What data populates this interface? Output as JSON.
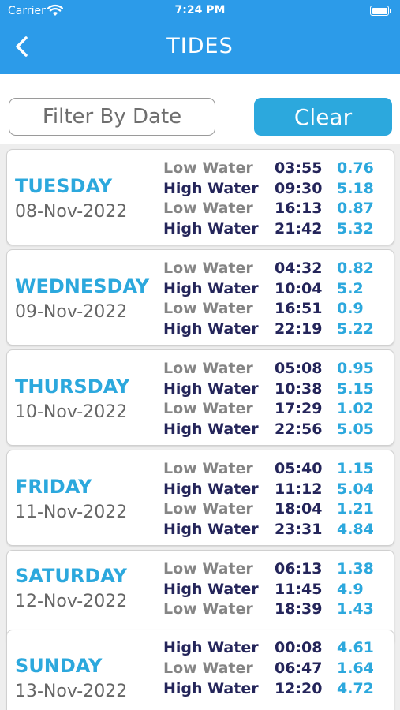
{
  "status_bar": {
    "carrier": "Carrier",
    "time": "7:24 PM"
  },
  "header": {
    "title": "TIDES",
    "back_icon": "chevron-left-icon"
  },
  "filter": {
    "placeholder": "Filter By Date",
    "clear_label": "Clear"
  },
  "days": [
    {
      "day": "TUESDAY",
      "date": "08-Nov-2022",
      "tides": [
        {
          "type": "Low Water",
          "time": "03:55",
          "height": "0.76"
        },
        {
          "type": "High Water",
          "time": "09:30",
          "height": "5.18"
        },
        {
          "type": "Low Water",
          "time": "16:13",
          "height": "0.87"
        },
        {
          "type": "High Water",
          "time": "21:42",
          "height": "5.32"
        }
      ]
    },
    {
      "day": "WEDNESDAY",
      "date": "09-Nov-2022",
      "tides": [
        {
          "type": "Low Water",
          "time": "04:32",
          "height": "0.82"
        },
        {
          "type": "High Water",
          "time": "10:04",
          "height": "5.2"
        },
        {
          "type": "Low Water",
          "time": "16:51",
          "height": "0.9"
        },
        {
          "type": "High Water",
          "time": "22:19",
          "height": "5.22"
        }
      ]
    },
    {
      "day": "THURSDAY",
      "date": "10-Nov-2022",
      "tides": [
        {
          "type": "Low Water",
          "time": "05:08",
          "height": "0.95"
        },
        {
          "type": "High Water",
          "time": "10:38",
          "height": "5.15"
        },
        {
          "type": "Low Water",
          "time": "17:29",
          "height": "1.02"
        },
        {
          "type": "High Water",
          "time": "22:56",
          "height": "5.05"
        }
      ]
    },
    {
      "day": "FRIDAY",
      "date": "11-Nov-2022",
      "tides": [
        {
          "type": "Low Water",
          "time": "05:40",
          "height": "1.15"
        },
        {
          "type": "High Water",
          "time": "11:12",
          "height": "5.04"
        },
        {
          "type": "Low Water",
          "time": "18:04",
          "height": "1.21"
        },
        {
          "type": "High Water",
          "time": "23:31",
          "height": "4.84"
        }
      ]
    },
    {
      "day": "SATURDAY",
      "date": "12-Nov-2022",
      "tides": [
        {
          "type": "Low Water",
          "time": "06:13",
          "height": "1.38"
        },
        {
          "type": "High Water",
          "time": "11:45",
          "height": "4.9"
        },
        {
          "type": "Low Water",
          "time": "18:39",
          "height": "1.43"
        }
      ]
    },
    {
      "day": "SUNDAY",
      "date": "13-Nov-2022",
      "tides": [
        {
          "type": "High Water",
          "time": "00:08",
          "height": "4.61"
        },
        {
          "type": "Low Water",
          "time": "06:47",
          "height": "1.64"
        },
        {
          "type": "High Water",
          "time": "12:20",
          "height": "4.72"
        }
      ]
    }
  ]
}
